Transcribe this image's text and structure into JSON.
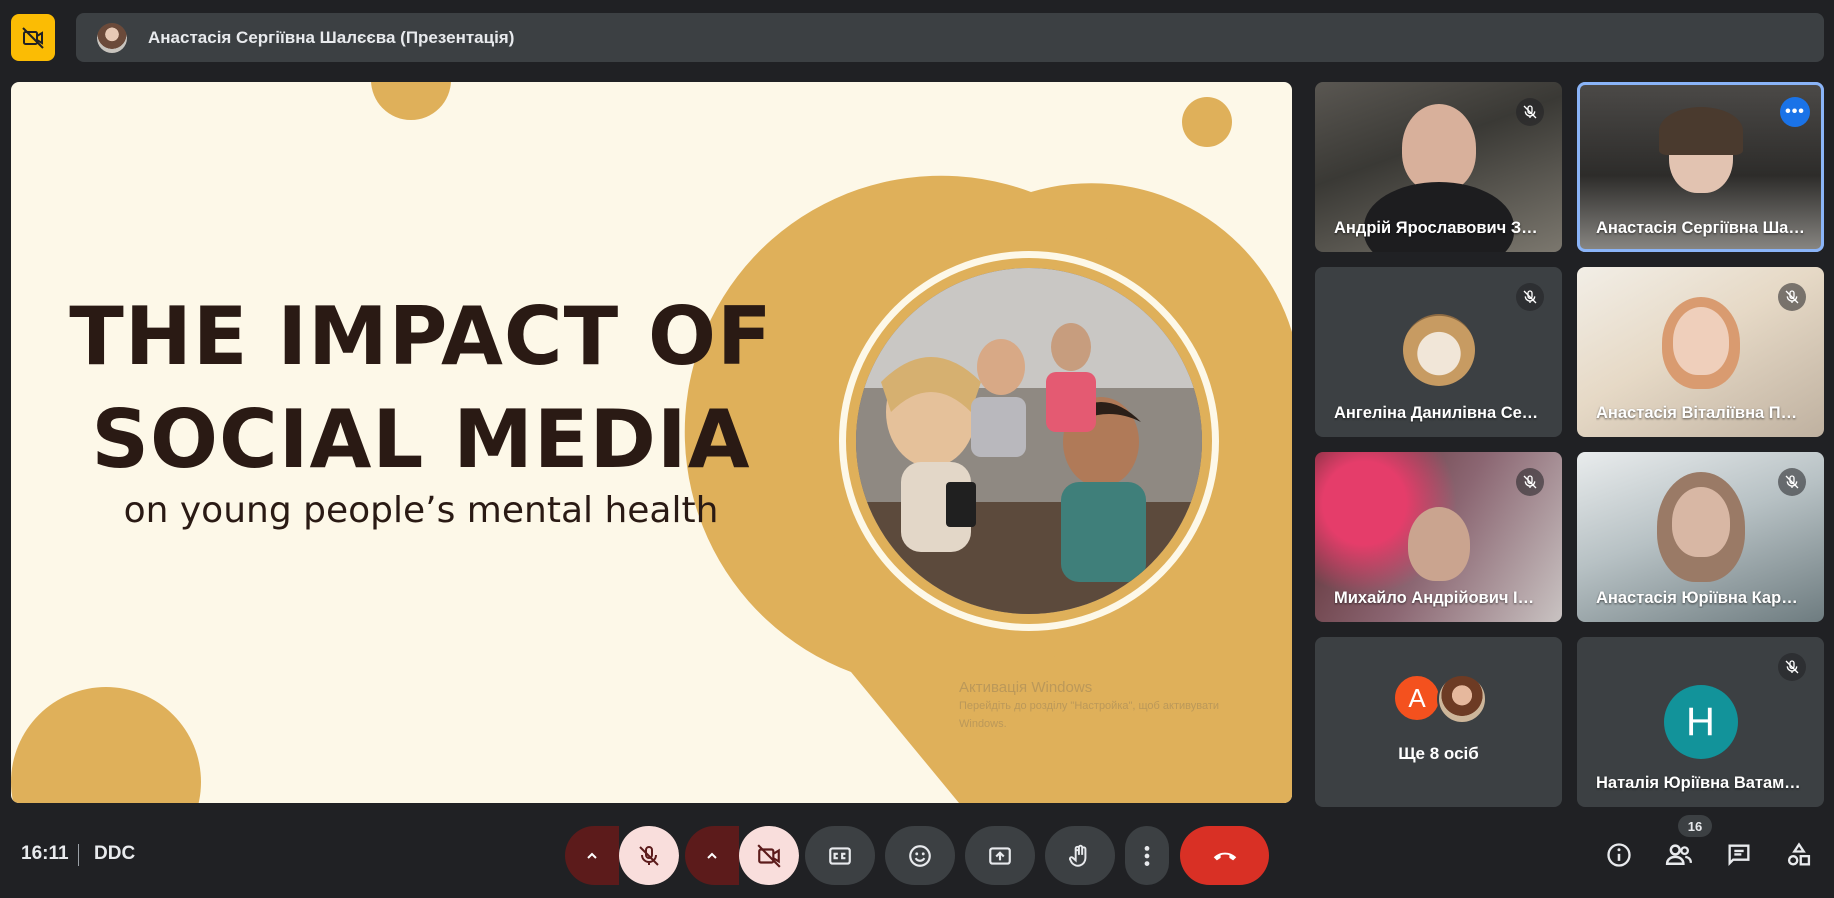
{
  "top_bar": {
    "presenter_label": "Анастасія Сергіївна Шалєєва (Презентація)",
    "camera_off_icon": "camera-off-icon"
  },
  "slide": {
    "title_line1": "THE IMPACT OF",
    "title_line2": "SOCIAL MEDIA",
    "subtitle": "on young people’s mental health",
    "watermark_line1": "Активація Windows",
    "watermark_line2": "Перейдіть до розділу \"Настройка\", щоб активувати",
    "watermark_line3": "Windows.",
    "accent_color": "#dfb05a",
    "background_color": "#fdf8e8"
  },
  "participants": [
    {
      "name": "Андрій Ярославович Завербний",
      "muted": true
    },
    {
      "name": "Анастасія Сергіївна Шалєєва",
      "muted": false,
      "active": true
    },
    {
      "name": "Ангеліна Данилівна Семенюк",
      "muted": true
    },
    {
      "name": "Анастасія Віталіївна Петрук",
      "muted": true
    },
    {
      "name": "Михайло Андрійович Іваненко",
      "muted": true
    },
    {
      "name": "Анастасія Юріївна Карпенко",
      "muted": true
    },
    {
      "name": "Наталія Юріївна Ватаманюк",
      "muted": true,
      "avatar_letter": "Н"
    }
  ],
  "more_people": {
    "label": "Ще 8 осіб",
    "avatar_letter": "А"
  },
  "bottom_bar": {
    "time": "16:11",
    "meeting_code": "DDC",
    "participant_count": "16"
  },
  "colors": {
    "background": "#202124",
    "tile": "#3c4043",
    "end_call": "#d93025",
    "active_outline": "#8ab4f8",
    "alert_yellow": "#fbbc04"
  }
}
